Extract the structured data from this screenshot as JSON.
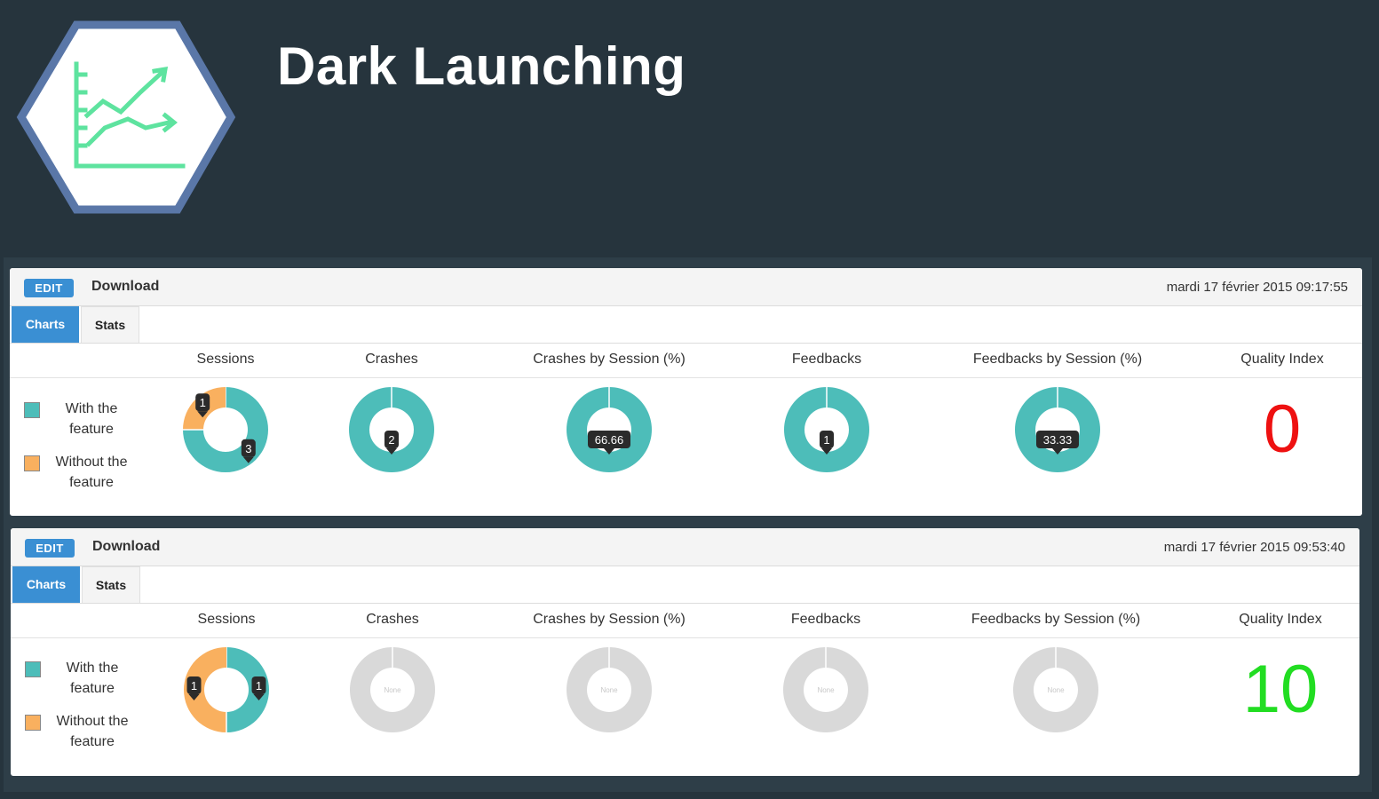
{
  "app": {
    "title": "Dark Launching",
    "logo_icon": "line-chart-icon",
    "colors": {
      "background": "#26343d",
      "accent": "#3a8fd3",
      "with_feature": "#4dbdb9",
      "without_feature": "#f9b05f",
      "empty": "#d9d9d9",
      "quality_bad": "#ee1111",
      "quality_good": "#22dd22"
    }
  },
  "panels": [
    {
      "edit_label": "EDIT",
      "name": "Download",
      "date": "mardi 17 février 2015 09:17:55",
      "tabs": [
        "Charts",
        "Stats"
      ],
      "active_tab": "Charts",
      "columns": [
        "Sessions",
        "Crashes",
        "Crashes by Session (%)",
        "Feedbacks",
        "Feedbacks by Session (%)",
        "Quality Index"
      ],
      "legend": [
        {
          "line1": "With the",
          "line2": "feature",
          "color": "#4dbdb9"
        },
        {
          "line1": "Without the",
          "line2": "feature",
          "color": "#f9b05f"
        }
      ],
      "quality_index": "0",
      "quality_color": "#ee1111"
    },
    {
      "edit_label": "EDIT",
      "name": "Download",
      "date": "mardi 17 février 2015 09:53:40",
      "tabs": [
        "Charts",
        "Stats"
      ],
      "active_tab": "Charts",
      "columns": [
        "Sessions",
        "Crashes",
        "Crashes by Session (%)",
        "Feedbacks",
        "Feedbacks by Session (%)",
        "Quality Index"
      ],
      "legend": [
        {
          "line1": "With the",
          "line2": "feature",
          "color": "#4dbdb9"
        },
        {
          "line1": "Without the",
          "line2": "feature",
          "color": "#f9b05f"
        }
      ],
      "quality_index": "10",
      "quality_color": "#22dd22"
    }
  ],
  "chart_data": [
    {
      "type": "pie",
      "title": "Sessions",
      "categories": [
        "With the feature",
        "Without the feature"
      ],
      "values": [
        3,
        1
      ]
    },
    {
      "type": "pie",
      "title": "Crashes",
      "categories": [
        "With the feature",
        "Without the feature"
      ],
      "values": [
        2,
        0
      ]
    },
    {
      "type": "pie",
      "title": "Crashes by Session (%)",
      "categories": [
        "With the feature",
        "Without the feature"
      ],
      "values": [
        66.66,
        0
      ]
    },
    {
      "type": "pie",
      "title": "Feedbacks",
      "categories": [
        "With the feature",
        "Without the feature"
      ],
      "values": [
        1,
        0
      ]
    },
    {
      "type": "pie",
      "title": "Feedbacks by Session (%)",
      "categories": [
        "With the feature",
        "Without the feature"
      ],
      "values": [
        33.33,
        0
      ]
    },
    {
      "type": "pie",
      "title": "Sessions",
      "categories": [
        "With the feature",
        "Without the feature"
      ],
      "values": [
        1,
        1
      ]
    },
    {
      "type": "pie",
      "title": "Crashes",
      "categories": [],
      "values": [],
      "empty_label": "None"
    },
    {
      "type": "pie",
      "title": "Crashes by Session (%)",
      "categories": [],
      "values": [],
      "empty_label": "None"
    },
    {
      "type": "pie",
      "title": "Feedbacks",
      "categories": [],
      "values": [],
      "empty_label": "None"
    },
    {
      "type": "pie",
      "title": "Feedbacks by Session (%)",
      "categories": [],
      "values": [],
      "empty_label": "None"
    }
  ]
}
